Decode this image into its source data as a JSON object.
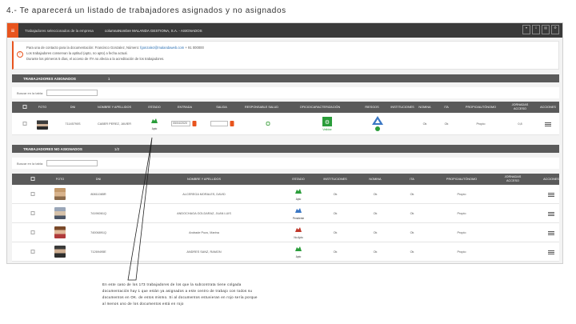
{
  "slide": {
    "title": "4.- Te aparecerá un listado de trabajadores asignados y no asignados"
  },
  "topbar": {
    "menu_icon": "hamburger-icon",
    "left_label": "Trabajadores seleccionados de la empresa",
    "center_label": "columnaNombre MALANDA GESTIONA, S.A. - ASIGNADOS"
  },
  "notice": {
    "line1_a": "Para una de contacto para la documentación: Francisco Gonzalez, Número:",
    "line1_link": "fgonzalez@malandaweb.com",
    "line1_b": "+ 91 000000",
    "line2": "Los trabajadores conservan la aptitud (apto, no apto) a fecha actual.",
    "line3": "Durante los primeros 5 días, el acceso de ITA no afecta a la acreditación de los trabajadores."
  },
  "assigned": {
    "title": "TRABAJADORES ASIGNADOS",
    "count": "1",
    "search_label": "Buscar en la tabla:",
    "columns": [
      "FOTO",
      "DNI",
      "NOMBRE Y APELLIDOS",
      "ESTADO",
      "ENTRADA",
      "SALIDA",
      "RESPONSABLE SALUD",
      "OFICIO/CARACTERIZACIÓN",
      "RIESGOS",
      "INSTITUCIONES",
      "NOMINA",
      "ITA",
      "PROPIO/AUTÓNOMO",
      "JORNADAS ACCESO",
      "ACCIONES"
    ],
    "rows": [
      {
        "dni": "71145790S",
        "name": "CABER PEREZ, JAVIER",
        "state": "Apto",
        "entrada": "05/04/2020",
        "oficio": "Validar",
        "nomina": "Ok",
        "ita": "Ok",
        "propio": "Propio",
        "jornadas": "0,8"
      }
    ]
  },
  "unassigned": {
    "title": "TRABAJADORES NO ASIGNADOS",
    "count": "1/2",
    "search_label": "Buscar en la tabla:",
    "columns": [
      "FOTO",
      "DNI",
      "NOMBRE Y APELLIDOS",
      "ESTADO",
      "INSTITUCIONES",
      "NOMINA",
      "ITA",
      "PROPIO/AUTÓNOMO",
      "JORNADAS ACCESO",
      "ACCIONES"
    ],
    "rows": [
      {
        "dni": "80811085R",
        "name": "ALCEREGA MORALES, DAVID",
        "state": "Apto",
        "inst": "Ok",
        "nomina": "Ok",
        "ita": "Ok",
        "propio": "Propio"
      },
      {
        "dni": "74196061Q",
        "name": "ANDOCHAGA GOLDARAZ, JUAN LUIS",
        "state": "Pendiente",
        "inst": "Ok",
        "nomina": "Ok",
        "ita": "Ok",
        "propio": "Propio"
      },
      {
        "dni": "74006891Q",
        "name": "Andrade Pozo, Marina",
        "state": "No Apto",
        "inst": "Ok",
        "nomina": "Ok",
        "ita": "Ok",
        "propio": "Propio"
      },
      {
        "dni": "71269495E",
        "name": "ANDRES SANZ, RAMON",
        "state": "Apto",
        "inst": "Ok",
        "nomina": "Ok",
        "ita": "Ok",
        "propio": "Propio"
      }
    ]
  },
  "callout": {
    "text": "En este caso de los 173 trabajadores de los que la subcontrata tiene colgada documentación hay 1 que están ya asignados a este centro de trabajo con todos su documentos en OK. de estos mismo. Si al documentos estuvieran en rojo sería porque al menos uno de los documentos está en rojo"
  },
  "colors": {
    "accent": "#e8541e",
    "header": "#5a5a5a",
    "topbar": "#3a3a3a",
    "ok": "#2a9d3a",
    "link": "#2a6fb3"
  }
}
